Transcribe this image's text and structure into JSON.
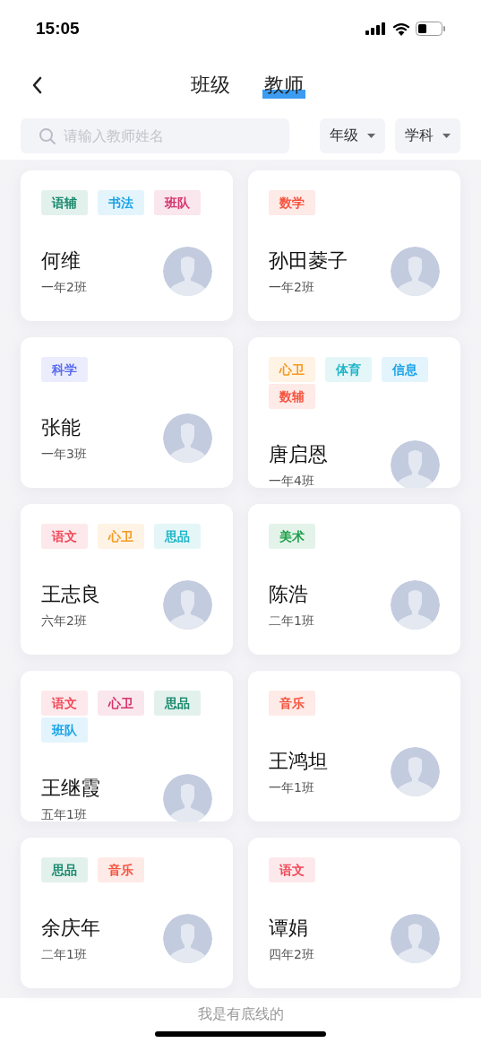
{
  "status_bar": {
    "time": "15:05"
  },
  "tabs": [
    {
      "label": "班级",
      "selected": false
    },
    {
      "label": "教师",
      "selected": true
    }
  ],
  "search": {
    "placeholder": "请输入教师姓名"
  },
  "filters": [
    "年级",
    "学科"
  ],
  "teachers": [
    {
      "name": "何维",
      "class": "一年2班",
      "tags": [
        {
          "label": "语辅",
          "color": "#1a8a6e"
        },
        {
          "label": "书法",
          "color": "#1aa3e8"
        },
        {
          "label": "班队",
          "color": "#d6336c"
        }
      ]
    },
    {
      "name": "孙田菱子",
      "class": "一年2班",
      "tags": [
        {
          "label": "数学",
          "color": "#f5533d"
        }
      ]
    },
    {
      "name": "张能",
      "class": "一年3班",
      "tags": [
        {
          "label": "科学",
          "color": "#5b6cf0"
        }
      ]
    },
    {
      "name": "唐启恩",
      "class": "一年4班",
      "tags": [
        {
          "label": "心卫",
          "color": "#f59a23"
        },
        {
          "label": "体育",
          "color": "#1fb5c9"
        },
        {
          "label": "信息",
          "color": "#1aa3e8"
        },
        {
          "label": "数辅",
          "color": "#f5533d"
        }
      ]
    },
    {
      "name": "王志良",
      "class": "六年2班",
      "tags": [
        {
          "label": "语文",
          "color": "#f04a5a"
        },
        {
          "label": "心卫",
          "color": "#f59a23"
        },
        {
          "label": "思品",
          "color": "#1fb5c9"
        }
      ]
    },
    {
      "name": "陈浩",
      "class": "二年1班",
      "tags": [
        {
          "label": "美术",
          "color": "#1fa04a"
        }
      ]
    },
    {
      "name": "王继霞",
      "class": "五年1班",
      "tags": [
        {
          "label": "语文",
          "color": "#f04a5a"
        },
        {
          "label": "心卫",
          "color": "#d6336c"
        },
        {
          "label": "思品",
          "color": "#1a8a6e"
        },
        {
          "label": "班队",
          "color": "#1aa3e8"
        }
      ]
    },
    {
      "name": "王鸿坦",
      "class": "一年1班",
      "tags": [
        {
          "label": "音乐",
          "color": "#f5533d"
        }
      ]
    },
    {
      "name": "余庆年",
      "class": "二年1班",
      "tags": [
        {
          "label": "思品",
          "color": "#1a8a6e"
        },
        {
          "label": "音乐",
          "color": "#f5533d"
        }
      ]
    },
    {
      "name": "谭娟",
      "class": "四年2班",
      "tags": [
        {
          "label": "语文",
          "color": "#f04a5a"
        }
      ]
    }
  ],
  "footer": "我是有底线的"
}
